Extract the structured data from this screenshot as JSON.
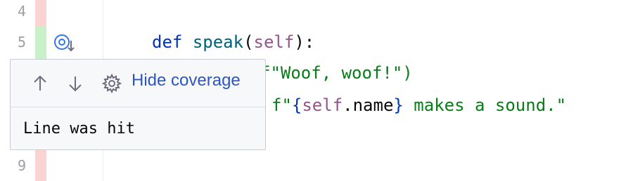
{
  "gutter": {
    "line_numbers": [
      "4",
      "5",
      "9"
    ]
  },
  "code": {
    "line5": {
      "keyword": "def",
      "name": "speak",
      "open": "(",
      "self": "self",
      "close": "):"
    },
    "line6": {
      "partial": "f\"Woof, woof!\")"
    },
    "line7": {
      "prefix": "f\"",
      "brace_open": "{",
      "self": "self",
      "attr": ".name",
      "brace_close": "}",
      "rest": " makes a sound.\""
    }
  },
  "coverage": {
    "hit_color": "#c9f0c9",
    "miss_color": "#fbd3d3"
  },
  "popup": {
    "hide_label": "Hide coverage",
    "status": "Line was hit"
  },
  "icons": {
    "gutter": "coverage-target-icon",
    "prev": "arrow-up-icon",
    "next": "arrow-down-icon",
    "settings": "gear-icon"
  }
}
